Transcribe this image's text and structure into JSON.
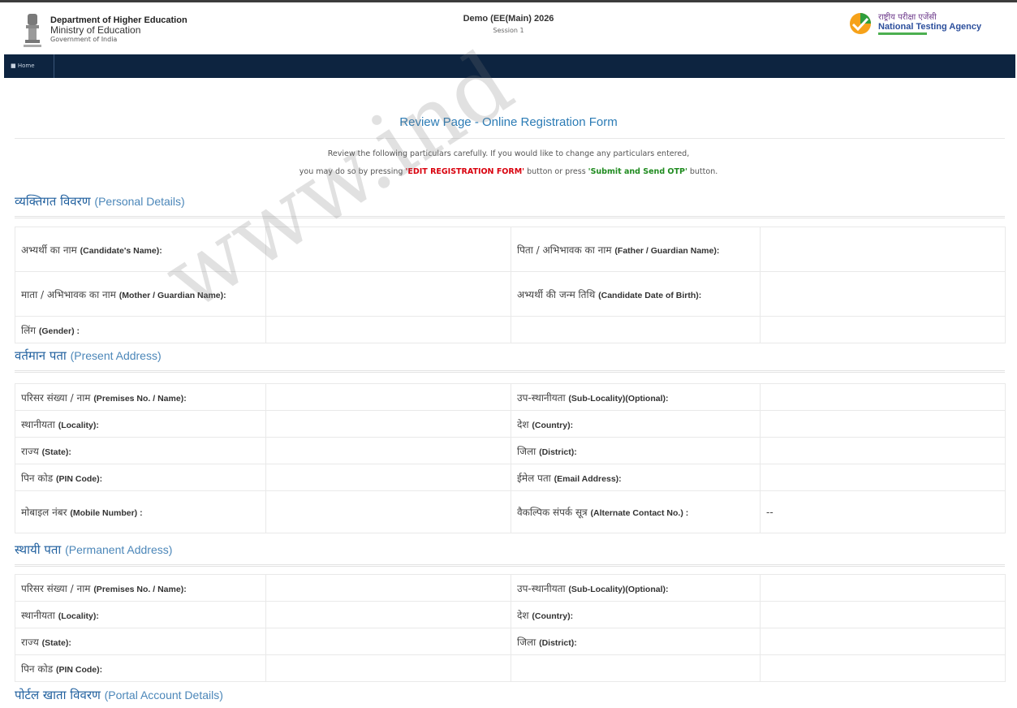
{
  "header": {
    "dept_line1": "Department of Higher Education",
    "dept_line2": "Ministry of Education",
    "dept_line3": "Government of India",
    "exam_title": "Demo (EE(Main) 2026",
    "exam_session": "Session 1",
    "nta_hindi": "राष्ट्रीय परीक्षा एजेंसी",
    "nta_english": "National Testing Agency"
  },
  "nav": {
    "home": "■ Home"
  },
  "page_title": "Review Page - Online Registration Form",
  "notice": {
    "line1": "Review the following particulars carefully. If you would like to change any particulars entered,",
    "line2_pre": "you may do so by pressing ",
    "edit_btn": "'EDIT REGISTRATION FORM'",
    "line2_mid": " button or press ",
    "submit_btn": "'Submit and Send OTP'",
    "line2_post": " button."
  },
  "watermark": "www.ind",
  "personal": {
    "heading_hi": "व्यक्तिगत विवरण",
    "heading_en": "(Personal Details)",
    "rows": [
      [
        "अभ्यर्थी का नाम ",
        "(Candidate's Name):",
        "पिता / अभिभावक का नाम ",
        "(Father / Guardian Name):"
      ],
      [
        "माता / अभिभावक का नाम ",
        "(Mother / Guardian Name):",
        "अभ्यर्थी की जन्म तिथि ",
        "(Candidate Date of Birth):"
      ],
      [
        "लिंग ",
        "(Gender) :",
        "",
        ""
      ]
    ]
  },
  "present": {
    "heading_hi": "वर्तमान पता",
    "heading_en": "(Present Address)",
    "rows": [
      [
        "परिसर संख्या / नाम ",
        "(Premises No. / Name):",
        "उप-स्थानीयता ",
        "(Sub-Locality)(Optional):"
      ],
      [
        "स्थानीयता ",
        "(Locality):",
        "देश ",
        "(Country):"
      ],
      [
        "राज्य ",
        "(State):",
        "जिला ",
        "(District):"
      ],
      [
        "पिन कोड ",
        "(PIN Code):",
        "ईमेल पता ",
        "(Email Address):"
      ],
      [
        "मोबाइल नंबर ",
        "(Mobile Number) :",
        "वैकल्पिक संपर्क सूत्र ",
        "(Alternate Contact No.) :"
      ]
    ],
    "alternate_value": "--"
  },
  "permanent": {
    "heading_hi": "स्थायी पता",
    "heading_en": "(Permanent Address)",
    "rows": [
      [
        "परिसर संख्या / नाम ",
        "(Premises No. / Name):",
        "उप-स्थानीयता ",
        "(Sub-Locality)(Optional):"
      ],
      [
        "स्थानीयता ",
        "(Locality):",
        "देश ",
        "(Country):"
      ],
      [
        "राज्य ",
        "(State):",
        "जिला ",
        "(District):"
      ],
      [
        "पिन कोड ",
        "(PIN Code):",
        "",
        ""
      ]
    ]
  },
  "portal": {
    "heading_hi": "पोर्टल खाता विवरण",
    "heading_en": "(Portal Account Details)"
  }
}
